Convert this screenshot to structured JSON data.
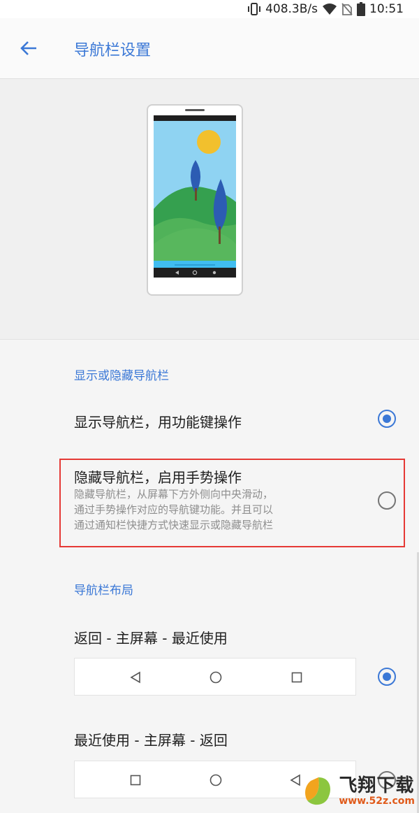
{
  "status_bar": {
    "speed": "408.3B/s",
    "time": "10:51"
  },
  "app_bar": {
    "title": "导航栏设置"
  },
  "visibility_section": {
    "header": "显示或隐藏导航栏",
    "options": [
      {
        "title": "显示导航栏，用功能键操作",
        "selected": true
      },
      {
        "title": "隐藏导航栏，启用手势操作",
        "subtitle_lines": [
          "隐藏导航栏，从屏幕下方外侧向中央滑动，",
          "通过手势操作对应的导航键功能。并且可以",
          "通过通知栏快捷方式快速显示或隐藏导航栏"
        ],
        "selected": false
      }
    ]
  },
  "layout_section": {
    "header": "导航栏布局",
    "options": [
      {
        "title": "返回 - 主屏幕 - 最近使用",
        "selected": true,
        "buttons": [
          "back-icon",
          "home-icon",
          "recents-icon"
        ]
      },
      {
        "title": "最近使用 - 主屏幕 - 返回",
        "selected": false,
        "buttons": [
          "recents-icon",
          "home-icon",
          "back-icon"
        ]
      }
    ]
  },
  "watermark": {
    "main": "飞翔下载",
    "sub": "www.52z.com"
  },
  "colors": {
    "accent": "#3b78d6",
    "highlight": "#e53935"
  }
}
